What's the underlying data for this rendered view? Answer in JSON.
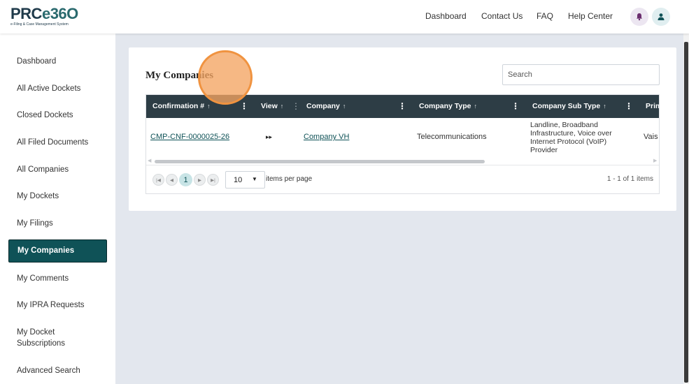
{
  "header": {
    "logo_main": "PRCe360",
    "logo_sub": "e-Filing & Case Management System",
    "nav": [
      "Dashboard",
      "Contact Us",
      "FAQ",
      "Help Center"
    ],
    "icons": [
      "bell-icon",
      "user-icon"
    ]
  },
  "sidebar": {
    "items": [
      "Dashboard",
      "All Active Dockets",
      "Closed Dockets",
      "All Filed Documents",
      "All Companies",
      "My Dockets",
      "My Filings",
      "My Companies",
      "My Comments",
      "My IPRA Requests",
      "My Docket Subscriptions",
      "Advanced Search"
    ],
    "active": "My Companies"
  },
  "main": {
    "title": "My Companies",
    "search_placeholder": "Search",
    "columns": [
      "Confirmation #",
      "View",
      "Company",
      "Company Type",
      "Company Sub Type",
      "Prim"
    ],
    "rows": [
      {
        "confirmation": "CMP-CNF-0000025-26",
        "view_icon": "▸▸",
        "company": "Company VH",
        "company_type": "Telecommunications",
        "company_sub_type": "Landline, Broadband Infrastructure, Voice over Internet Protocol (VoIP) Provider",
        "primary": "Vais"
      }
    ],
    "pager": {
      "current_page": "1",
      "page_size": "10",
      "items_per_page_label": "items per page",
      "info": "1 - 1 of 1 items"
    }
  },
  "colors": {
    "accent": "#0f5257",
    "table_header": "#2d3d45",
    "highlight_ring": "#f09340"
  }
}
